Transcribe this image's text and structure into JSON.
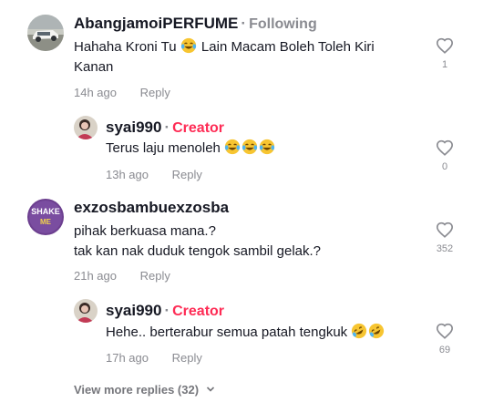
{
  "comments": [
    {
      "username": "AbangjamoiPERFUME",
      "relation": "Following",
      "text_line1": "Hahaha Kroni Tu",
      "text_line1b": "Lain Macam Boleh Toleh Kiri",
      "text_line2": "Kanan",
      "time": "14h ago",
      "reply_label": "Reply",
      "likes": "1",
      "emoji": "laughing-tears",
      "avatar_icon": "car-avatar-icon"
    },
    {
      "username": "syai990",
      "badge": "Creator",
      "text": "Terus laju menoleh",
      "time": "13h ago",
      "reply_label": "Reply",
      "likes": "0",
      "emoji": "laughing-tears x3",
      "avatar_icon": "person-avatar-icon"
    },
    {
      "username": "exzosbambuexzosba",
      "text_line1": "pihak berkuasa mana.?",
      "text_line2": "tak kan nak duduk tengok sambil gelak.?",
      "time": "21h ago",
      "reply_label": "Reply",
      "likes": "352",
      "avatar_icon": "shake-logo-avatar-icon",
      "avatar_text_top": "SHAKE",
      "avatar_text_bottom": "ME"
    },
    {
      "username": "syai990",
      "badge": "Creator",
      "text": "Hehe.. berterabur semua patah tengkuk",
      "time": "17h ago",
      "reply_label": "Reply",
      "likes": "69",
      "emoji": "rolling-laughing x2",
      "avatar_icon": "person-avatar-icon"
    }
  ],
  "view_more": "View more replies (32)",
  "colors": {
    "text": "#161823",
    "muted": "#8a8b91",
    "creator": "#fe2c55"
  }
}
